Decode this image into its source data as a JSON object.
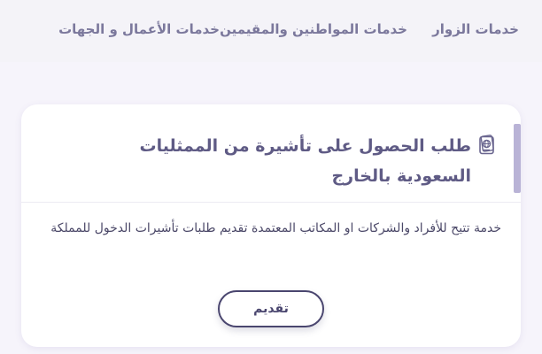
{
  "nav": {
    "items": [
      {
        "label": "خدمات الزوار"
      },
      {
        "label": "خدمات المواطنين والمقيمين"
      },
      {
        "label": "خدمات الأعمال و الجهات"
      }
    ]
  },
  "card": {
    "icon": "passport-icon",
    "title": "طلب الحصول على تأشيرة من الممثليات السعودية بالخارج",
    "description": "خدمة تتيح للأفراد والشركات او المكاتب المعتمدة تقديم طلبات تأشيرات الدخول للمملكة",
    "apply_label": "تقديم"
  },
  "colors": {
    "nav_text": "#7b789c",
    "title_text": "#5f5b85",
    "button_border": "#4a466f",
    "accent_bar": "#b9b3d6"
  }
}
